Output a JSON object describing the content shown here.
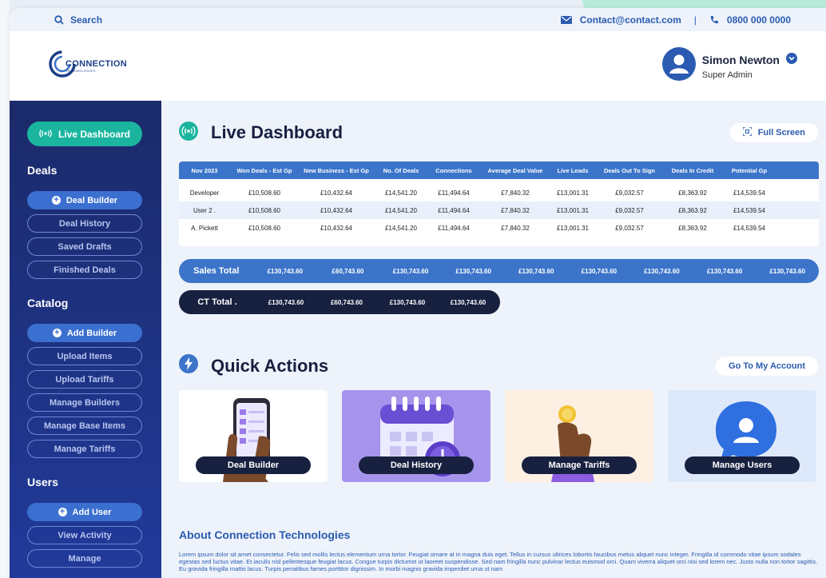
{
  "topbar": {
    "search_label": "Search",
    "email": "Contact@contact.com",
    "separator": "|",
    "phone": "0800 000 0000"
  },
  "logo": {
    "name": "CONNECTION",
    "tagline": "TECHNOLOGIES"
  },
  "user": {
    "name": "Simon Newton",
    "role": "Super Admin"
  },
  "sidebar": {
    "live_dashboard": "Live Dashboard",
    "deals": {
      "title": "Deals",
      "primary": "Deal Builder",
      "items": [
        "Deal History",
        "Saved Drafts",
        "Finished Deals"
      ]
    },
    "catalog": {
      "title": "Catalog",
      "primary": "Add Builder",
      "items": [
        "Upload Items",
        "Upload Tariffs",
        "Manage Builders",
        "Manage Base Items",
        "Manage Tariffs"
      ]
    },
    "users": {
      "title": "Users",
      "primary": "Add User",
      "items": [
        "View Activity",
        "Manage"
      ]
    }
  },
  "dashboard": {
    "title": "Live Dashboard",
    "fullscreen_label": "Full Screen",
    "table": {
      "headers": [
        "Nov 2023",
        "Won Deals - Est Gp",
        "New Business - Est Gp",
        "No. Of Deals",
        "Connections",
        "Average Deal Value",
        "Live Leads",
        "Deals Out To Sign",
        "Deals In Credit",
        "Potential Gp"
      ],
      "rows": [
        [
          "Developer",
          "£10,508.60",
          "£10,432.64",
          "£14,541.20",
          "£11,494.64",
          "£7,840.32",
          "£13,001.31",
          "£9,032.57",
          "£8,363.92",
          "£14,539.54"
        ],
        [
          "User 2 .",
          "£10,508.60",
          "£10,432.64",
          "£14,541.20",
          "£11,494.64",
          "£7,840.32",
          "£13,001.31",
          "£9,032.57",
          "£8,363.92",
          "£14,539.54"
        ],
        [
          "A. Pickett",
          "£10,508.60",
          "£10,432.64",
          "£14,541.20",
          "£11,494.64",
          "£7,840.32",
          "£13,001.31",
          "£9,032.57",
          "£8,363.92",
          "£14,539.54"
        ]
      ]
    },
    "sales_total": {
      "label": "Sales Total",
      "values": [
        "£130,743.60",
        "£60,743.60",
        "£130,743.60",
        "£130,743.60",
        "£130,743.60",
        "£130,743.60",
        "£130,743.60",
        "£130,743.60",
        "£130,743.60"
      ]
    },
    "ct_total": {
      "label": "CT Total .",
      "values": [
        "£130,743.60",
        "£60,743.60",
        "£130,743.60",
        "£130,743.60"
      ]
    }
  },
  "quick_actions": {
    "title": "Quick Actions",
    "account_label": "Go To My Account",
    "cards": [
      "Deal Builder",
      "Deal History",
      "Manage Tariffs",
      "Manage Users"
    ]
  },
  "about": {
    "title": "About Connection Technologies",
    "text": "Lorem ipsum dolor sit amet consectetur. Felis sed mollis lectus elementum urna tortor. Feugiat ornare at in magna duis eget. Tellus in cursus ultrices lobortis faucibus metus aliquet nunc integer. Fringilla id commodo vitae ipsum sodales egestas sed luctus vitae. Et iaculis nisl pellentesque feugiat lacus. Congue turpis dictumst ut laoreet suspendisse. Sed nam fringilla nunc pulvinar lectus euismod orci. Quam viverra aliquet orci nisi sed lorem nec. Justo nulla non tortor sagittis. Eu gravida fringilla mattis lacus. Turpis penatibus fames porttitor dignissim. In morbi magnis gravida imperdiet urna ut nam"
  },
  "colors": {
    "accent": "#1bb59f",
    "primary": "#3b74c9",
    "navy": "#17203f",
    "sidebar": "#1b2a6a"
  }
}
